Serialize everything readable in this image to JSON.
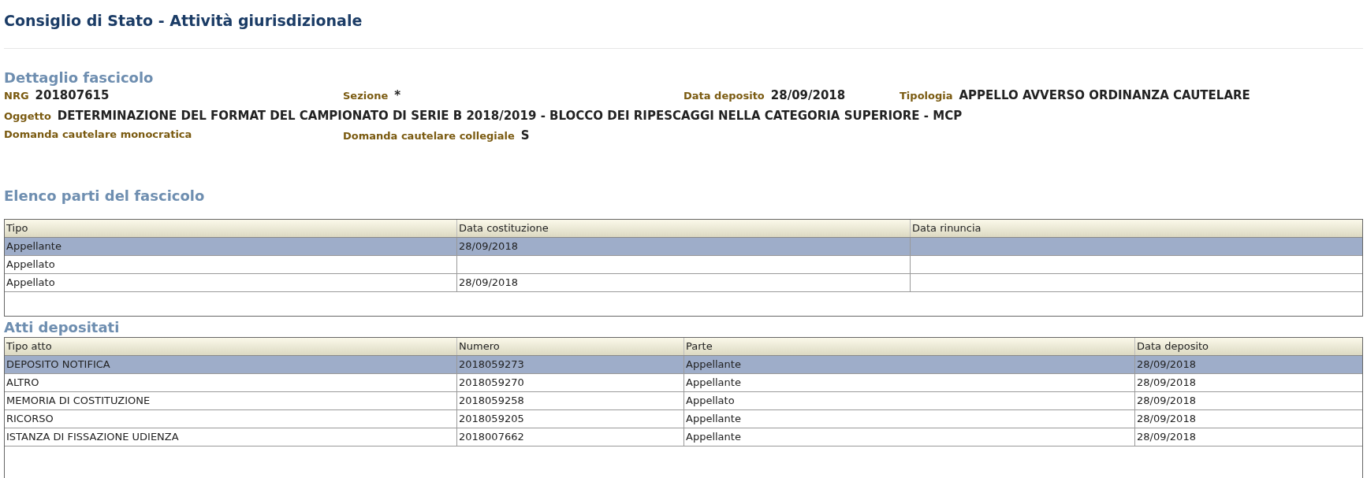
{
  "page_title": "Consiglio di Stato - Attività giurisdizionale",
  "detail": {
    "title": "Dettaglio fascicolo",
    "fields": [
      {
        "label": "NRG",
        "value": "201807615"
      },
      {
        "label": "Sezione",
        "value": "*"
      },
      {
        "label": "Data deposito",
        "value": "28/09/2018"
      },
      {
        "label": "Tipologia",
        "value": "APPELLO AVVERSO ORDINANZA CAUTELARE"
      }
    ],
    "subject": {
      "label": "Oggetto",
      "value": "DETERMINAZIONE DEL FORMAT DEL CAMPIONATO DI SERIE B 2018/2019 - BLOCCO DEI RIPESCAGGI NELLA CATEGORIA SUPERIORE - MCP"
    },
    "requests": [
      {
        "label": "Domanda cautelare monocratica"
      },
      {
        "label": "Domanda cautelare collegiale",
        "value": "S"
      }
    ]
  },
  "parties": {
    "title": "Elenco parti del fascicolo",
    "columns": [
      "Tipo",
      "Data costituzione",
      "Data rinuncia"
    ],
    "rows": [
      {
        "selected": true,
        "cells": [
          "Appellante",
          "28/09/2018",
          ""
        ]
      },
      {
        "selected": false,
        "cells": [
          "Appellato",
          "",
          ""
        ]
      },
      {
        "selected": false,
        "cells": [
          "Appellato",
          "28/09/2018",
          ""
        ]
      }
    ]
  },
  "acts": {
    "title": "Atti depositati",
    "columns": [
      "Tipo atto",
      "Numero",
      "Parte",
      "Data deposito"
    ],
    "rows": [
      {
        "selected": true,
        "cells": [
          "DEPOSITO NOTIFICA",
          "2018059273",
          "Appellante",
          "28/09/2018"
        ]
      },
      {
        "selected": false,
        "cells": [
          "ALTRO",
          "2018059270",
          "Appellante",
          "28/09/2018"
        ]
      },
      {
        "selected": false,
        "cells": [
          "MEMORIA DI COSTITUZIONE",
          "2018059258",
          "Appellato",
          "28/09/2018"
        ]
      },
      {
        "selected": false,
        "cells": [
          "RICORSO",
          "2018059205",
          "Appellante",
          "28/09/2018"
        ]
      },
      {
        "selected": false,
        "cells": [
          "ISTANZA DI FISSAZIONE UDIENZA",
          "2018007662",
          "Appellante",
          "28/09/2018"
        ]
      }
    ]
  }
}
